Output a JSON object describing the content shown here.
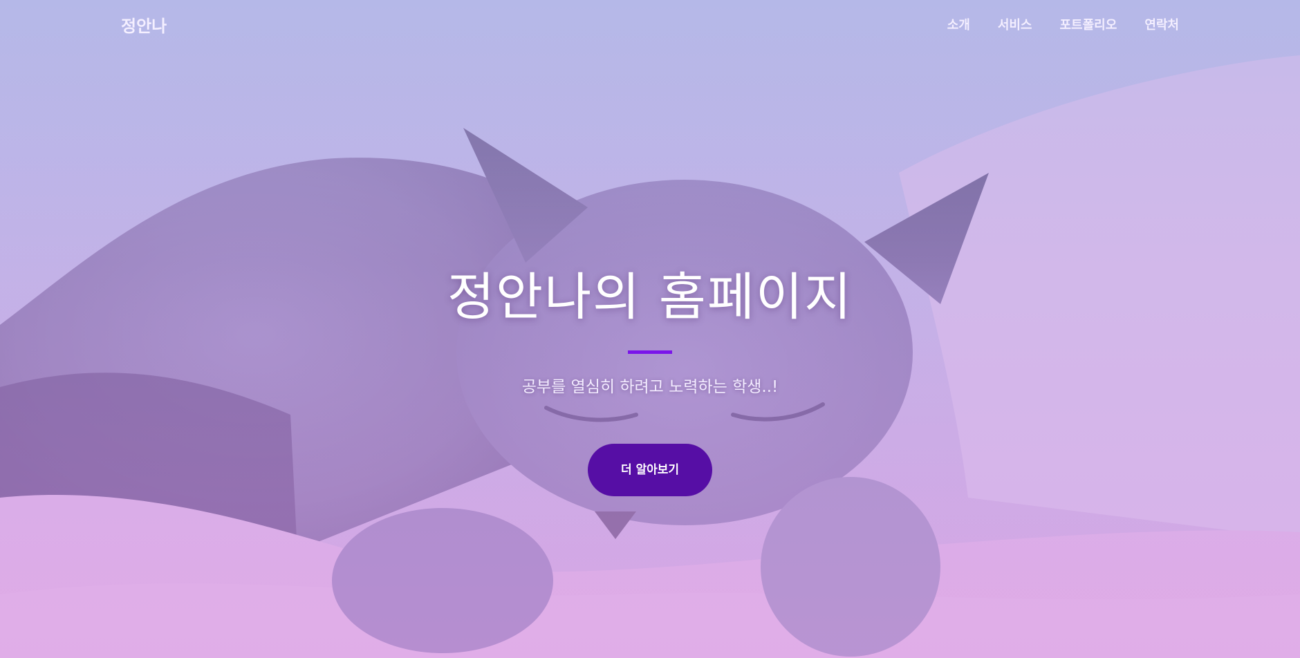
{
  "navbar": {
    "brand": "정안나",
    "links": [
      "소개",
      "서비스",
      "포트폴리오",
      "연락처"
    ]
  },
  "hero": {
    "title": "정안나의 홈페이지",
    "subtitle": "공부를 열심히 하려고 노력하는 학생..!",
    "cta_label": "더 알아보기"
  },
  "colors": {
    "accent": "#7a14ea",
    "button": "#560ea5",
    "overlay_top": "#b2b6e8",
    "overlay_bottom": "#d7a0e6"
  }
}
